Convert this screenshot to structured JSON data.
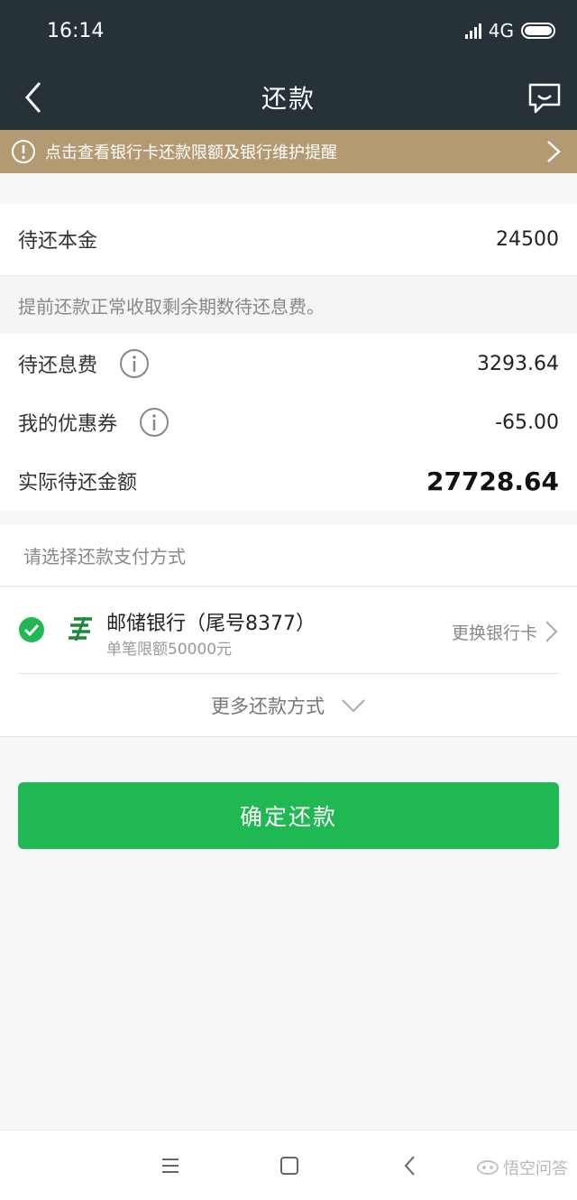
{
  "status_bar": {
    "time": "16:14",
    "network": "4G"
  },
  "nav": {
    "title": "还款"
  },
  "notice": {
    "text": "点击查看银行卡还款限额及银行维护提醒"
  },
  "principal": {
    "label": "待还本金",
    "value": "24500"
  },
  "note": "提前还款正常收取剩余期数待还息费。",
  "interest": {
    "label": "待还息费",
    "value": "3293.64"
  },
  "coupon": {
    "label": "我的优惠券",
    "value": "-65.00"
  },
  "total": {
    "label": "实际待还金额",
    "value": "27728.64"
  },
  "payment": {
    "hint": "请选择还款支付方式",
    "bank_name": "邮储银行（尾号8377）",
    "bank_limit": "单笔限额50000元",
    "change_card": "更换银行卡",
    "more": "更多还款方式"
  },
  "confirm_button": "确定还款",
  "watermark": "悟空问答",
  "colors": {
    "header": "#263238",
    "notice": "#b49a72",
    "primary": "#1fb852"
  }
}
